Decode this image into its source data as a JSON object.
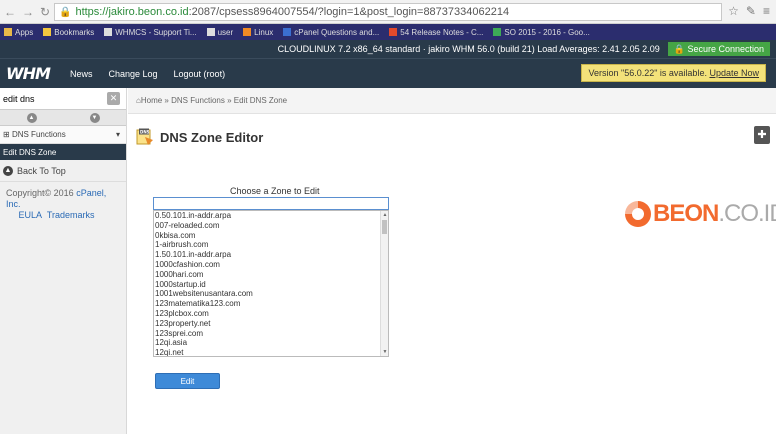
{
  "browser": {
    "url_host": "https://jakiro.beon.co.id",
    "url_path": ":2087/cpsess8964007554/?login=1&post_login=88737334062214"
  },
  "bookmarks": [
    "Apps",
    "Bookmarks",
    "WHMCS - Support Ti...",
    "user",
    "Linux",
    "cPanel Questions and...",
    "54 Release Notes - C...",
    "SO 2015 - 2016 - Goo..."
  ],
  "whm_top": {
    "info": "CLOUDLINUX 7.2 x86_64 standard · jakiro   WHM 56.0 (build 21)   Load Averages: 2.41 2.05 2.09",
    "secure": "Secure Connection"
  },
  "whm_nav": {
    "logo": "WHM",
    "links": [
      "News",
      "Change Log",
      "Logout (root)"
    ],
    "version_notice": "Version \"56.0.22\" is available.",
    "update_link": "Update Now"
  },
  "sidebar": {
    "search_value": "edit dns",
    "category": "DNS Functions",
    "active_item": "Edit DNS Zone",
    "back_to_top": "Back To Top",
    "copyright": "Copyright© 2016",
    "cpanel_link": "cPanel, Inc.",
    "eula": "EULA",
    "trademarks": "Trademarks"
  },
  "breadcrumb": "Home » DNS Functions » Edit DNS Zone",
  "page": {
    "title": "DNS Zone Editor",
    "zone_label": "Choose a Zone to Edit",
    "zone_input_value": "",
    "zones": [
      "0.50.101.in-addr.arpa",
      "007-reloaded.com",
      "0kbisa.com",
      "1-airbrush.com",
      "1.50.101.in-addr.arpa",
      "1000cfashion.com",
      "1000hari.com",
      "1000startup.id",
      "1001websitenusantara.com",
      "123matematika123.com",
      "123plcbox.com",
      "123property.net",
      "123sprei.com",
      "12qi.asia",
      "12qi.net"
    ],
    "edit_button": "Edit"
  },
  "brand": {
    "part1": "BEON",
    "part2": ".CO.ID"
  }
}
